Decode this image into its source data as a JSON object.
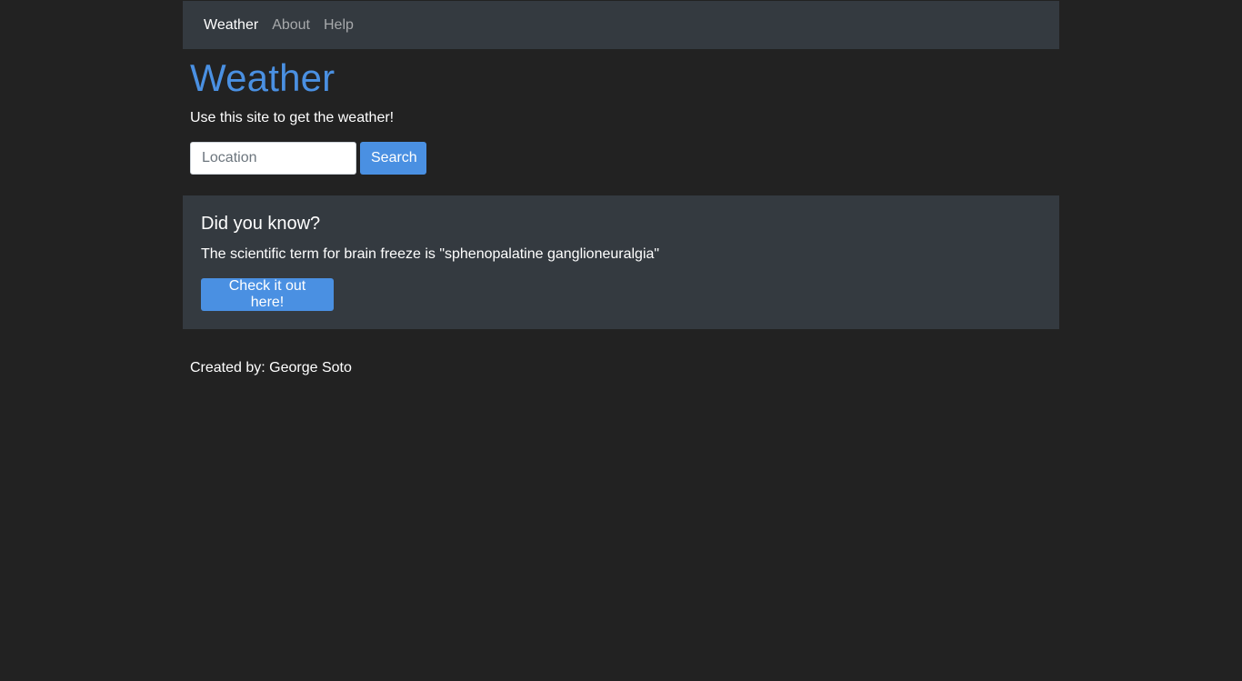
{
  "nav": {
    "items": [
      {
        "label": "Weather",
        "active": true
      },
      {
        "label": "About",
        "active": false
      },
      {
        "label": "Help",
        "active": false
      }
    ]
  },
  "header": {
    "title": "Weather",
    "subtitle": "Use this site to get the weather!"
  },
  "search": {
    "placeholder": "Location",
    "value": "",
    "button_label": "Search"
  },
  "fact": {
    "title": "Did you know?",
    "text": "The scientific term for brain freeze is \"sphenopalatine ganglioneuralgia\"",
    "button_label": "Check it out here!"
  },
  "footer": {
    "text": "Created by: George Soto"
  },
  "colors": {
    "background": "#222222",
    "panel": "#343a40",
    "accent": "#4a90e2",
    "nav_inactive": "#a7a9ab"
  }
}
